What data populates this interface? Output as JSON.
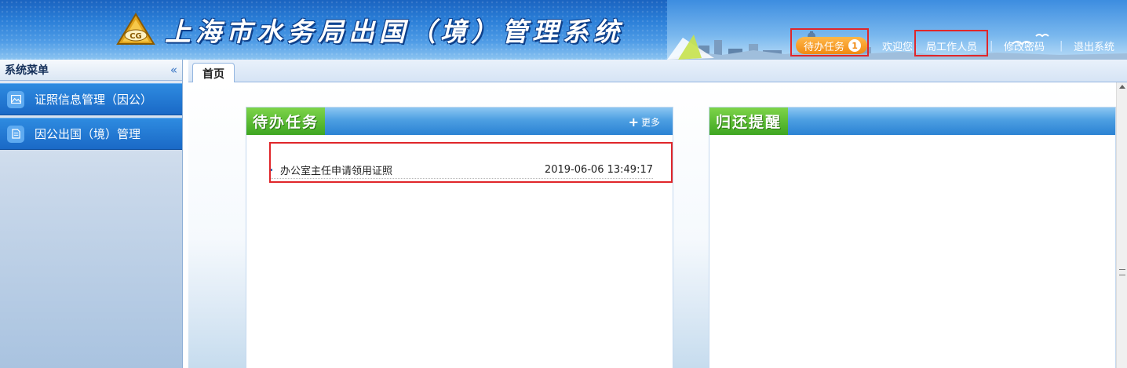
{
  "app": {
    "title": "上海市水务局出国（境）管理系统",
    "logo_text": "CG"
  },
  "topnav": {
    "todo_label": "待办任务",
    "todo_count": "1",
    "welcome_label": "欢迎您：",
    "user_name": "局工作人员",
    "separator": "|",
    "change_password": "修改密码",
    "logout": "退出系统"
  },
  "sidebar": {
    "title": "系统菜单",
    "collapse_icon": "«",
    "items": [
      {
        "label": "证照信息管理（因公）",
        "icon": "image-icon"
      },
      {
        "label": "因公出国（境）管理",
        "icon": "document-icon"
      }
    ]
  },
  "tabs": [
    {
      "label": "首页",
      "active": true
    }
  ],
  "panels": {
    "todo": {
      "title": "待办任务",
      "more_label": "更多",
      "items": [
        {
          "title": "办公室主任申请领用证照",
          "time": "2019-06-06 13:49:17"
        }
      ]
    },
    "reminder": {
      "title": "归还提醒"
    }
  },
  "colors": {
    "accent": "#2b82d3",
    "header": "#1a63c0",
    "panel_title": "#3ea621",
    "highlight": "#e0262a"
  }
}
